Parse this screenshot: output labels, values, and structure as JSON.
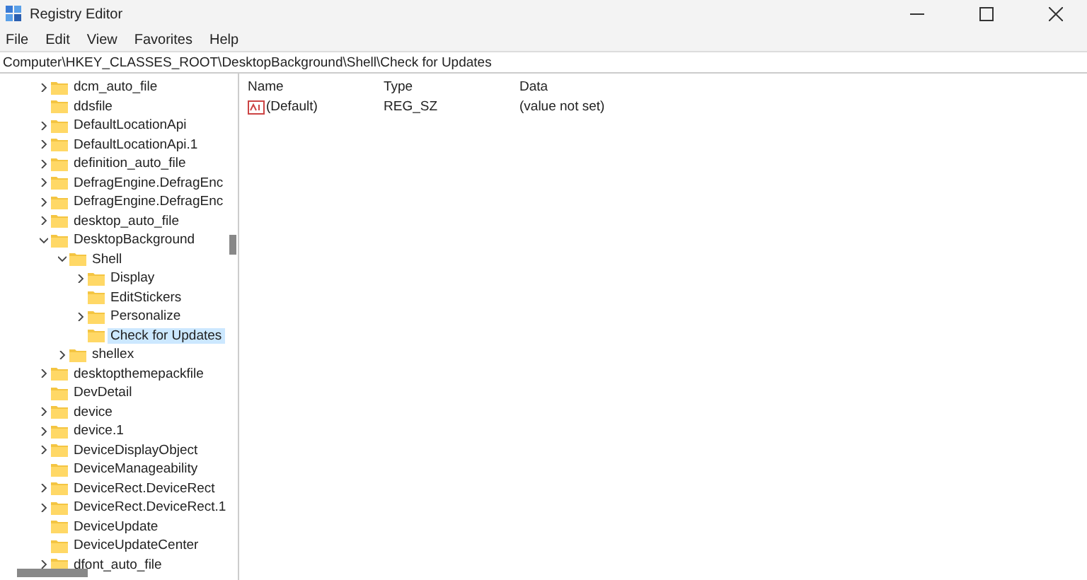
{
  "window": {
    "title": "Registry Editor"
  },
  "menu": [
    "File",
    "Edit",
    "View",
    "Favorites",
    "Help"
  ],
  "address": "Computer\\HKEY_CLASSES_ROOT\\DesktopBackground\\Shell\\Check for Updates",
  "tree": [
    {
      "label": "dcm_auto_file",
      "expandable": true,
      "expanded": false,
      "selected": false
    },
    {
      "label": "ddsfile",
      "expandable": false,
      "selected": false
    },
    {
      "label": "DefaultLocationApi",
      "expandable": true,
      "expanded": false,
      "selected": false
    },
    {
      "label": "DefaultLocationApi.1",
      "expandable": true,
      "expanded": false,
      "selected": false
    },
    {
      "label": "definition_auto_file",
      "expandable": true,
      "expanded": false,
      "selected": false
    },
    {
      "label": "DefragEngine.DefragEnc",
      "expandable": true,
      "expanded": false,
      "selected": false
    },
    {
      "label": "DefragEngine.DefragEnc",
      "expandable": true,
      "expanded": false,
      "selected": false
    },
    {
      "label": "desktop_auto_file",
      "expandable": true,
      "expanded": false,
      "selected": false
    },
    {
      "label": "DesktopBackground",
      "expandable": true,
      "expanded": true,
      "selected": false,
      "children": [
        {
          "label": "Shell",
          "expandable": true,
          "expanded": true,
          "selected": false,
          "children": [
            {
              "label": "Display",
              "expandable": true,
              "expanded": false,
              "selected": false
            },
            {
              "label": "EditStickers",
              "expandable": false,
              "selected": false
            },
            {
              "label": "Personalize",
              "expandable": true,
              "expanded": false,
              "selected": false
            },
            {
              "label": "Check for Updates",
              "expandable": false,
              "selected": true
            }
          ]
        },
        {
          "label": "shellex",
          "expandable": true,
          "expanded": false,
          "selected": false
        }
      ]
    },
    {
      "label": "desktopthemepackfile",
      "expandable": true,
      "expanded": false,
      "selected": false
    },
    {
      "label": "DevDetail",
      "expandable": false,
      "selected": false
    },
    {
      "label": "device",
      "expandable": true,
      "expanded": false,
      "selected": false
    },
    {
      "label": "device.1",
      "expandable": true,
      "expanded": false,
      "selected": false
    },
    {
      "label": "DeviceDisplayObject",
      "expandable": true,
      "expanded": false,
      "selected": false
    },
    {
      "label": "DeviceManageability",
      "expandable": false,
      "selected": false
    },
    {
      "label": "DeviceRect.DeviceRect",
      "expandable": true,
      "expanded": false,
      "selected": false
    },
    {
      "label": "DeviceRect.DeviceRect.1",
      "expandable": true,
      "expanded": false,
      "selected": false
    },
    {
      "label": "DeviceUpdate",
      "expandable": false,
      "selected": false
    },
    {
      "label": "DeviceUpdateCenter",
      "expandable": false,
      "selected": false
    },
    {
      "label": "dfont_auto_file",
      "expandable": true,
      "expanded": false,
      "selected": false
    }
  ],
  "values": {
    "columns": [
      "Name",
      "Type",
      "Data"
    ],
    "rows": [
      {
        "name": "(Default)",
        "type": "REG_SZ",
        "data": "(value not set)"
      }
    ]
  }
}
